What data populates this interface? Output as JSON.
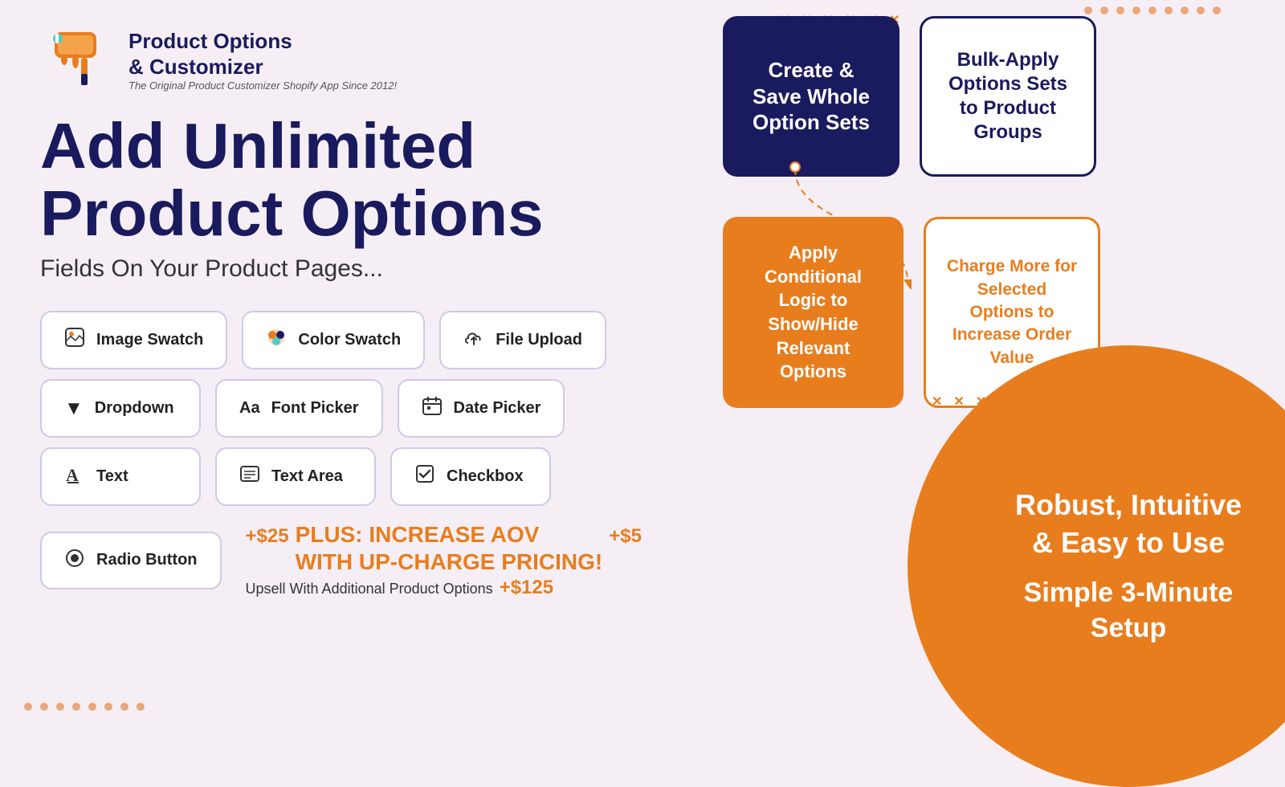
{
  "logo": {
    "title_line1": "Product Options",
    "title_line2": "& Customizer",
    "subtitle": "The Original Product Customizer Shopify App Since 2012!"
  },
  "main_heading": "Add Unlimited",
  "main_heading2": "Product Options",
  "sub_heading": "Fields On Your  Product Pages...",
  "options": [
    {
      "id": "image-swatch",
      "label": "Image Swatch",
      "icon": "🖼"
    },
    {
      "id": "color-swatch",
      "label": "Color Swatch",
      "icon": "🎨"
    },
    {
      "id": "file-upload",
      "label": "File Upload",
      "icon": "🔗"
    },
    {
      "id": "dropdown",
      "label": "Dropdown",
      "icon": "▼"
    },
    {
      "id": "font-picker",
      "label": "Font Picker",
      "icon": "Aa"
    },
    {
      "id": "date-picker",
      "label": "Date Picker",
      "icon": "📅"
    },
    {
      "id": "text",
      "label": "Text",
      "icon": "A"
    },
    {
      "id": "text-area",
      "label": "Text Area",
      "icon": "📄"
    },
    {
      "id": "checkbox",
      "label": "Checkbox",
      "icon": "☑"
    },
    {
      "id": "radio-button",
      "label": "Radio Button",
      "icon": "◉"
    }
  ],
  "aov": {
    "title": "PLUS: INCREASE AOV\nWITH UP-CHARGE PRICING!",
    "subtitle": "Upsell With Additional Product Options",
    "price1": "+$5",
    "price2": "+$125",
    "price3": "+$25"
  },
  "feature_cards": [
    {
      "id": "create-save",
      "label": "Create & Save Whole Option Sets",
      "style": "dark"
    },
    {
      "id": "bulk-apply",
      "label": "Bulk-Apply Options Sets to Product Groups",
      "style": "dark-outline"
    },
    {
      "id": "conditional-logic",
      "label": "Apply Conditional Logic to Show/Hide Relevant Options",
      "style": "orange"
    },
    {
      "id": "charge-more",
      "label": "Charge More for Selected Options to Increase Order Value",
      "style": "orange-outline"
    }
  ],
  "bottom_right": {
    "text1": "Robust, Intuitive\n& Easy to Use",
    "text2": "Simple 3-Minute\nSetup"
  },
  "dots": {
    "count": 9,
    "color": "#e8a87c"
  }
}
